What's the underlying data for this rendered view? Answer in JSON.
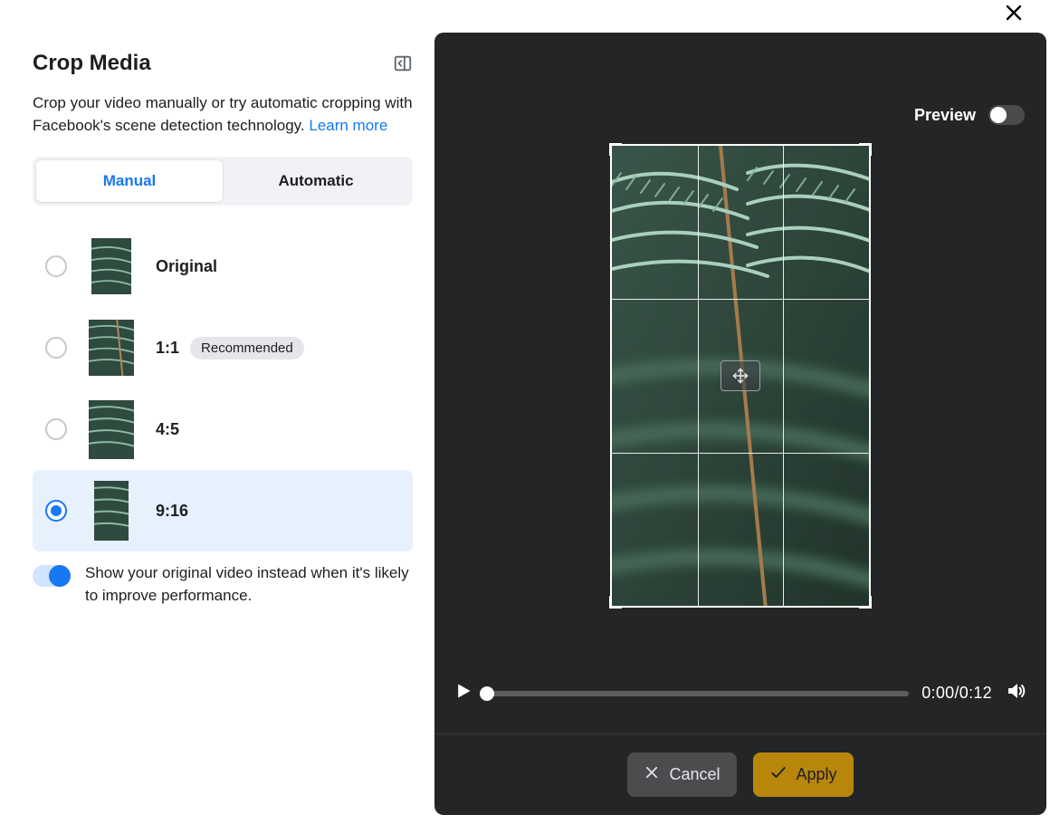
{
  "header": {
    "title": "Crop Media",
    "description_pre": "Crop your video manually or try automatic cropping with Facebook's scene detection technology. ",
    "learn_more": "Learn more"
  },
  "tabs": {
    "manual": "Manual",
    "automatic": "Automatic"
  },
  "ratios": {
    "original": "Original",
    "one_one": "1:1",
    "recommended": "Recommended",
    "four_five": "4:5",
    "nine_sixteen": "9:16"
  },
  "performance": {
    "text": "Show your original video instead when it's likely to improve performance."
  },
  "preview": {
    "label": "Preview",
    "time": "0:00/0:12"
  },
  "footer": {
    "cancel": "Cancel",
    "apply": "Apply"
  }
}
